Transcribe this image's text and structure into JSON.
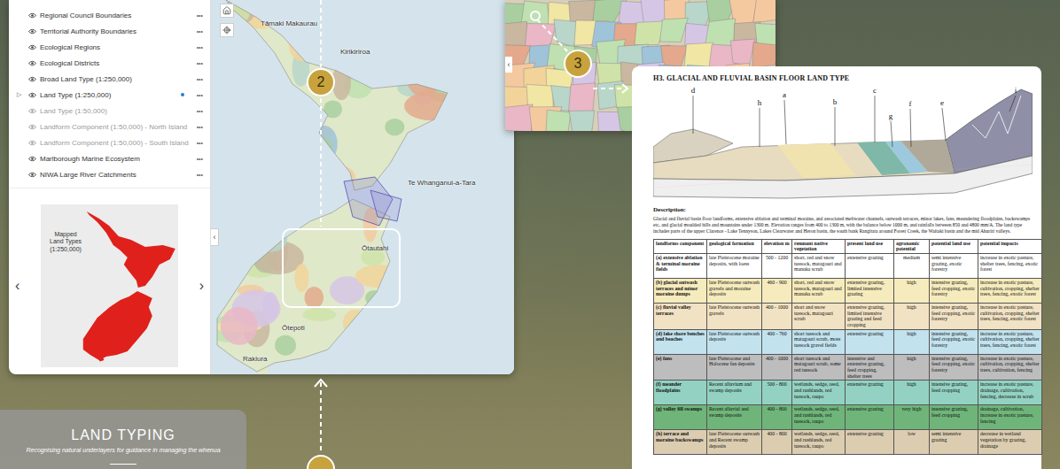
{
  "map_app": {
    "layers": [
      {
        "label": "Regional Council Boundaries",
        "visible": true,
        "dimmed": false,
        "expandable": false,
        "active": false
      },
      {
        "label": "Territorial Authority Boundaries",
        "visible": true,
        "dimmed": false,
        "expandable": false,
        "active": false
      },
      {
        "label": "Ecological Regions",
        "visible": true,
        "dimmed": false,
        "expandable": false,
        "active": false
      },
      {
        "label": "Ecological Districts",
        "visible": true,
        "dimmed": false,
        "expandable": false,
        "active": false
      },
      {
        "label": "Broad Land Type (1:250,000)",
        "visible": true,
        "dimmed": false,
        "expandable": false,
        "active": false
      },
      {
        "label": "Land Type (1:250,000)",
        "visible": true,
        "dimmed": false,
        "expandable": true,
        "active": true
      },
      {
        "label": "Land Type (1:50,000)",
        "visible": true,
        "dimmed": true,
        "expandable": false,
        "active": false
      },
      {
        "label": "Landform Component (1:50,000) - North Island",
        "visible": true,
        "dimmed": true,
        "expandable": false,
        "active": false
      },
      {
        "label": "Landform Component (1:50,000) - South Island",
        "visible": true,
        "dimmed": true,
        "expandable": false,
        "active": false
      },
      {
        "label": "Marlborough Marine Ecosystem",
        "visible": true,
        "dimmed": false,
        "expandable": false,
        "active": false
      },
      {
        "label": "NIWA Large River Catchments",
        "visible": true,
        "dimmed": false,
        "expandable": false,
        "active": false
      }
    ],
    "menu_glyph": "•••",
    "expander_glyph": "▷",
    "legend": {
      "lines": [
        "Mapped",
        "Land Types",
        "(1:250,000)"
      ],
      "prev": "‹",
      "next": "›"
    },
    "collapse": "‹",
    "places": [
      "Tāmaki Makaurau",
      "Kirikiriroa",
      "Te Whanganui-a-Tara",
      "Ōtautahi",
      "Ōtepoti",
      "Rakiura"
    ]
  },
  "zoom_map": {
    "collapse": "‹"
  },
  "callouts": [
    {
      "number": "2"
    },
    {
      "number": "3"
    }
  ],
  "document": {
    "title": "H3. GLACIAL AND FLUVIAL BASIN FLOOR LAND TYPE",
    "diagram_labels": [
      "d",
      "h",
      "a",
      "b",
      "c",
      "g",
      "f",
      "e",
      "i"
    ],
    "description_heading": "Description:",
    "description": "Glacial and fluvial basin floor landforms, extensive ablation and terminal moraine, and associated meltwater channels, outwash terraces, minor lakes, fans, meandering floodplains, backswamps etc, and glacial moulded hills and mountains under 1300 m. Elevation ranges from 400 to 1300 m, with the balance below 1000 m, and rainfalls between 850 and 4800 mm/A. The land type includes parts of the upper Clarence - Lake Tennyson, Lakes Clearwater and Heron basin, the south bank Rangitata around Forest Creek, the Waitaki basin and the mid Ahuriri valleys.",
    "columns": [
      "landforms component",
      "geological formation",
      "elevation m",
      "remnant native vegetation",
      "present land use",
      "agronomic potential",
      "potential land use",
      "potential impacts"
    ],
    "rows": [
      {
        "color": "#ffffff",
        "cells": [
          "(a) extensive ablation & terminal moraine fields",
          "late Pleistocene moraine deposits, with loess",
          "500 - 1200",
          "short, red and snow tussock, matagouri and manuka scrub",
          "extensive grazing",
          "medium",
          "semi intensive grazing, exotic forestry",
          "increase in exotic pasture, shelter trees, fencing, exotic forest"
        ]
      },
      {
        "color": "#f6ebbd",
        "cells": [
          "(b) glacial outwash terraces and minor moraine dumps",
          "late Pleistocene outwash gravels and moraine deposits",
          "460 - 900",
          "short, red and snow tussock, matagouri and manuka scrub",
          "extensive grazing, limited intensive grazing",
          "high",
          "intensive grazing, feed cropping, exotic forestry",
          "increase in exotic pasture, cultivation, cropping, shelter trees, fencing, exotic forest"
        ]
      },
      {
        "color": "#f1e2c4",
        "cells": [
          "(c) fluvial valley terraces",
          "late Pleistocene outwash gravels",
          "400 - 1000",
          "short and snow tussock, matagouri scrub",
          "extensive grazing, limited intensive grazing and feed cropping",
          "high",
          "intensive grazing, feed cropping, exotic forestry",
          "increase in exotic pasture, cultivation, cropping, shelter trees, fencing, exotic forest"
        ]
      },
      {
        "color": "#c2e2ee",
        "cells": [
          "(d) lake shore benches and beaches",
          "late Pleistocene outwash deposits",
          "400 - 760",
          "short tussock and matagouri scrub, moss tussock gravel fields",
          "extensive grazing",
          "high",
          "intensive grazing, feed cropping, exotic forestry",
          "increase in exotic pasture, cultivation, cropping, shelter trees, fencing, exotic forest"
        ]
      },
      {
        "color": "#bdbdbd",
        "cells": [
          "(e) fans",
          "late Pleistocene and Holocene fan deposits",
          "400 - 1000",
          "short tussock and matagouri scrub, some red tussock",
          "intensive and extensive grazing, feed cropping, shelter trees",
          "high",
          "intensive grazing, feed cropping, exotic forestry",
          "increase in exotic pasture, cultivation, cropping, shelter trees, cultivation, fencing"
        ]
      },
      {
        "color": "#93d2c2",
        "cells": [
          "(f) meander floodplains",
          "Recent alluvium and swamp deposits",
          "500 - 800",
          "wetlands, sedge, reed, and rushlands, red tussock, raupo",
          "extensive grazing",
          "high",
          "intensive grazing, feed cropping",
          "increase in exotic pasture, drainage, cultivation, fencing, decrease in scrub"
        ]
      },
      {
        "color": "#6fb57a",
        "cells": [
          "(g) valley fill swamps",
          "Recent alluvial and swamp deposits",
          "400 - 800",
          "wetlands, sedge, reed, and rushlands, red tussock, raupo",
          "extensive grazing",
          "very high",
          "intensive grazing, feed cropping",
          "drainage, cultivation, increase in exotic pasture, fencing"
        ]
      },
      {
        "color": "#dccdb1",
        "cells": [
          "(h) terrace and moraine backswamps",
          "late Pleistocene outwash and Recent swamp deposits",
          "400 - 800",
          "wetlands, sedge, reed, and rushlands, red tussock, raupo",
          "extensive grazing",
          "low",
          "semi intensive grazing",
          "decrease in wetland vegetation by grazing, drainage"
        ]
      }
    ]
  },
  "caption": {
    "title": "LAND TYPING",
    "subtitle": "Recognising natural underlayers for guidance in managing the whenua"
  }
}
